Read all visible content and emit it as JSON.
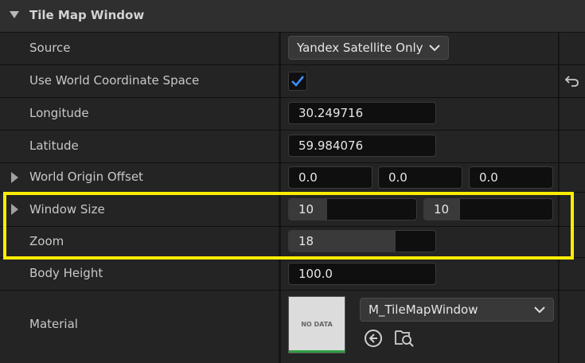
{
  "section": {
    "title": "Tile Map Window"
  },
  "rows": {
    "source": {
      "label": "Source",
      "value": "Yandex Satellite Only"
    },
    "use_world": {
      "label": "Use World Coordinate Space",
      "checked": true
    },
    "longitude": {
      "label": "Longitude",
      "value": "30.249716"
    },
    "latitude": {
      "label": "Latitude",
      "value": "59.984076"
    },
    "world_origin": {
      "label": "World Origin Offset",
      "x": "0.0",
      "y": "0.0",
      "z": "0.0"
    },
    "window_size": {
      "label": "Window Size",
      "x": "10",
      "y": "10"
    },
    "zoom": {
      "label": "Zoom",
      "value": "18"
    },
    "body_height": {
      "label": "Body Height",
      "value": "100.0"
    },
    "material": {
      "label": "Material",
      "asset": "M_TileMapWindow",
      "thumbnail_text": "NO DATA"
    }
  },
  "slider_levels": {
    "window_size_x": 0.3,
    "window_size_y": 0.28,
    "zoom": 0.73
  },
  "colors": {
    "highlight": "#ffee00",
    "check": "#3b8fff",
    "thumb_bar": "#2e9e42"
  },
  "icons": {
    "section_toggle": "caret-down-icon",
    "expand": "caret-right-icon",
    "dropdown": "chevron-down-icon",
    "reset": "reset-to-default-icon",
    "check": "checkmark-icon",
    "use_selected": "arrow-left-circle-icon",
    "browse": "browse-asset-icon"
  }
}
